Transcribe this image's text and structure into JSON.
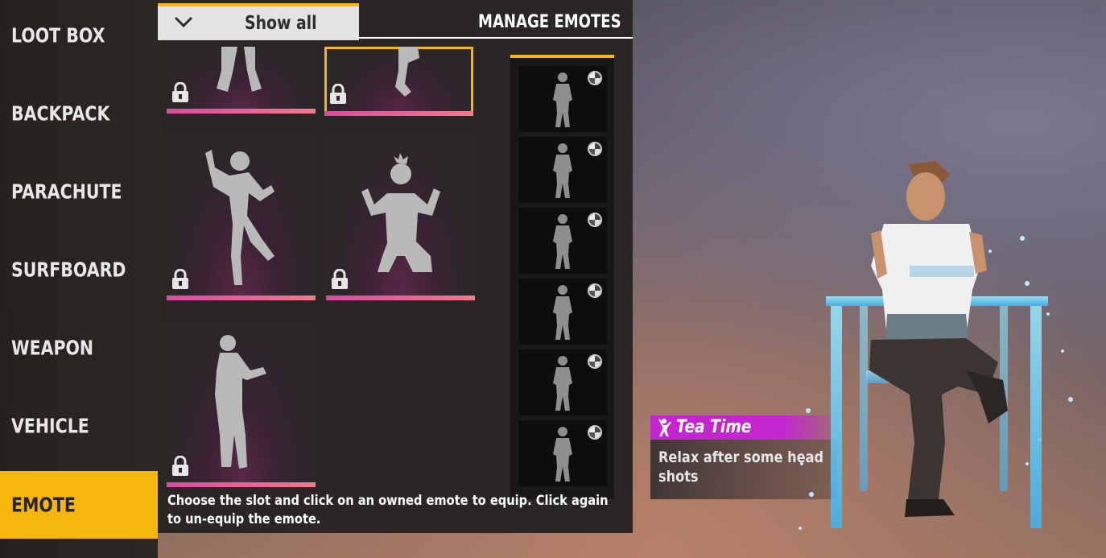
{
  "sidebar": {
    "items": [
      {
        "label": "LOOT BOX",
        "active": false
      },
      {
        "label": "BACKPACK",
        "active": false
      },
      {
        "label": "PARACHUTE",
        "active": false
      },
      {
        "label": "SURFBOARD",
        "active": false
      },
      {
        "label": "WEAPON",
        "active": false
      },
      {
        "label": "VEHICLE",
        "active": false
      },
      {
        "label": "EMOTE",
        "active": true
      }
    ]
  },
  "topbar": {
    "filter_label": "Show all",
    "manage_label": "MANAGE EMOTES"
  },
  "grid": {
    "cards": [
      {
        "icon": "lock-icon",
        "locked": true,
        "selected": false
      },
      {
        "icon": "lock-icon",
        "locked": true,
        "selected": true
      },
      {
        "icon": "lock-icon",
        "locked": true,
        "selected": false
      },
      {
        "icon": "lock-icon",
        "locked": true,
        "selected": false
      },
      {
        "icon": "lock-icon",
        "locked": true,
        "selected": false
      }
    ]
  },
  "slots": {
    "count": 6,
    "icon": "disc-icon"
  },
  "help_text": "Choose the slot and click on an owned emote to equip. Click again to un-equip the emote.",
  "emote_info": {
    "name": "Tea Time",
    "description": "Relax after some head shots",
    "icon": "dance-icon"
  },
  "colors": {
    "accent": "#f6b60d",
    "rarity_bar": "#d84aa3",
    "emote_header": "#c325cf"
  }
}
